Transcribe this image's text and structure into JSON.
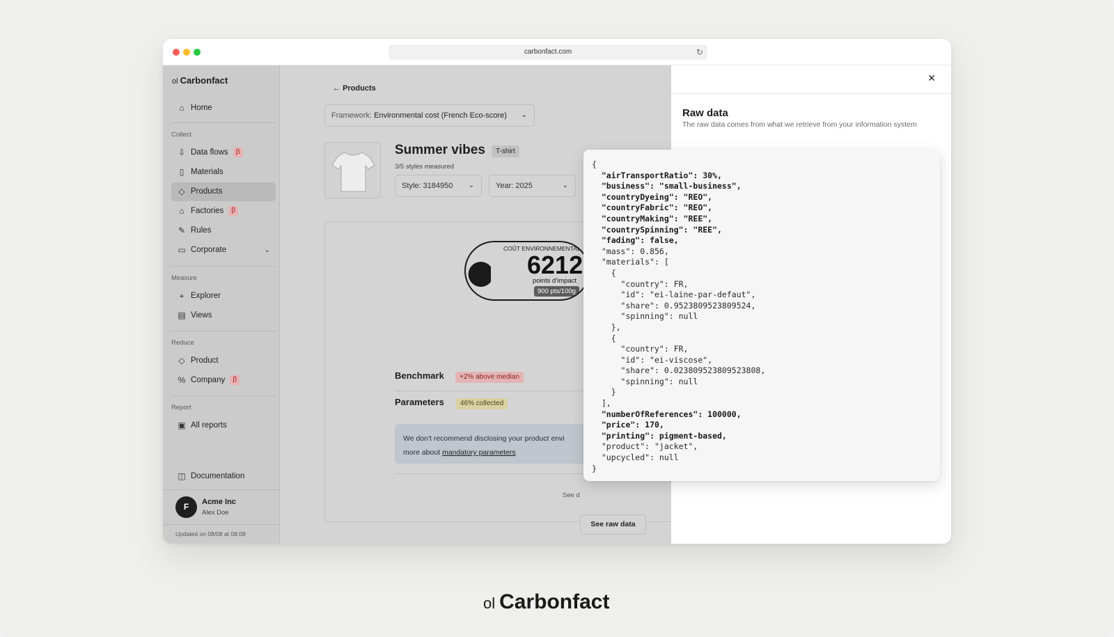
{
  "browser": {
    "url": "carbonfact.com"
  },
  "brand": {
    "mark": "ol",
    "name": "Carbonfact"
  },
  "sidebar": {
    "home": "Home",
    "collect_label": "Collect",
    "collect": [
      {
        "label": "Data flows",
        "beta": "β"
      },
      {
        "label": "Materials"
      },
      {
        "label": "Products"
      },
      {
        "label": "Factories",
        "beta": "β"
      },
      {
        "label": "Rules"
      },
      {
        "label": "Corporate"
      }
    ],
    "measure_label": "Measure",
    "measure": [
      {
        "label": "Explorer"
      },
      {
        "label": "Views"
      }
    ],
    "reduce_label": "Reduce",
    "reduce": [
      {
        "label": "Product"
      },
      {
        "label": "Company",
        "beta": "β"
      }
    ],
    "report_label": "Report",
    "report": [
      {
        "label": "All reports"
      }
    ],
    "documentation": "Documentation",
    "user": {
      "initial": "F",
      "org": "Acme Inc",
      "name": "Alex Doe"
    },
    "updated": "Updated on 08/08 at 08:08"
  },
  "main": {
    "back": "Products",
    "framework_label": "Framework:",
    "framework_value": "Environmental cost (French Eco-score)",
    "product_title": "Summer vibes",
    "product_tag": "T-shirt",
    "styles_measured": "3/5 styles measured",
    "style_select": "Style: 3184950",
    "year_select": "Year: 2025",
    "score_heading": "COÛT ENVIRONNEMENTAL",
    "score_value": "6212",
    "score_unit": "points d'impact",
    "score_sub": "900 pts/100g",
    "benchmark_label": "Benchmark",
    "benchmark_badge": "+2% above median",
    "parameters_label": "Parameters",
    "parameters_badge": "46% collected",
    "info_text": "We don't recommend disclosing your product envi",
    "info_more": "more about",
    "info_link": "mandatory parameters",
    "see_d": "See d",
    "raw_button": "See raw data"
  },
  "drawer": {
    "title": "Raw data",
    "description": "The raw data comes from what we retrieve from your information system"
  },
  "raw_json_lines": [
    {
      "text": "{",
      "bold": false
    },
    {
      "text": "  \"airTransportRatio\": 30%,",
      "bold": true
    },
    {
      "text": "  \"business\": \"small-business\",",
      "bold": true
    },
    {
      "text": "  \"countryDyeing\": \"REO\",",
      "bold": true
    },
    {
      "text": "  \"countryFabric\": \"REO\",",
      "bold": true
    },
    {
      "text": "  \"countryMaking\": \"REE\",",
      "bold": true
    },
    {
      "text": "  \"countrySpinning\": \"REE\",",
      "bold": true
    },
    {
      "text": "  \"fading\": false,",
      "bold": true
    },
    {
      "text": "  \"mass\": 0.856,",
      "bold": false
    },
    {
      "text": "  \"materials\": [",
      "bold": false
    },
    {
      "text": "    {",
      "bold": false
    },
    {
      "text": "      \"country\": FR,",
      "bold": false
    },
    {
      "text": "      \"id\": \"ei-laine-par-defaut\",",
      "bold": false
    },
    {
      "text": "      \"share\": 0.9523809523809524,",
      "bold": false
    },
    {
      "text": "      \"spinning\": null",
      "bold": false
    },
    {
      "text": "    },",
      "bold": false
    },
    {
      "text": "    {",
      "bold": false
    },
    {
      "text": "      \"country\": FR,",
      "bold": false
    },
    {
      "text": "      \"id\": \"ei-viscose\",",
      "bold": false
    },
    {
      "text": "      \"share\": 0.023809523809523808,",
      "bold": false
    },
    {
      "text": "      \"spinning\": null",
      "bold": false
    },
    {
      "text": "    }",
      "bold": false
    },
    {
      "text": "  ],",
      "bold": false
    },
    {
      "text": "  \"numberOfReferences\": 100000,",
      "bold": true
    },
    {
      "text": "  \"price\": 170,",
      "bold": true
    },
    {
      "text": "  \"printing\": pigment-based,",
      "bold": true
    },
    {
      "text": "  \"product\": \"jacket\",",
      "bold": false
    },
    {
      "text": "  \"upcycled\": null",
      "bold": false
    },
    {
      "text": "}",
      "bold": false
    }
  ],
  "footer": {
    "mark": "ol",
    "brand": "Carbonfact"
  }
}
